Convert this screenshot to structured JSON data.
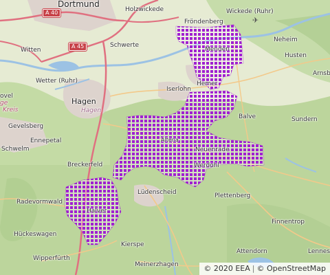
{
  "places": {
    "dortmund": "Dortmund",
    "holzwickede": "Holzwickede",
    "frondenberg": "Fröndenberg",
    "wickede": "Wickede (Ruhr)",
    "witten": "Witten",
    "schwerte": "Schwerte",
    "menden": "Menden",
    "neheim": "Neheim",
    "husten": "Husten",
    "arnsberg": "Arnsbe",
    "wetter": "Wetter (Ruhr)",
    "iserlohn": "Iserlohn",
    "hemer": "Hemer",
    "hagen": "Hagen",
    "hagen_region": "Hagen",
    "balve": "Balve",
    "sundern": "Sundern",
    "gevelsberg": "Gevelsberg",
    "ennepetal": "Ennepetal",
    "schwelm": "Schwelm",
    "altena": "Altena",
    "neuenrade": "Neuenrade",
    "werdohl": "Werdohl",
    "breckerfeld": "Breckerfeld",
    "ludenscheid": "Lüdenscheid",
    "plettenberg": "Plettenberg",
    "radevormwald": "Radevormwald",
    "halver": "Halver",
    "finnentrop": "Finnentrop",
    "huckeswagen": "Hückeswagen",
    "kierspe": "Kierspe",
    "attendorn": "Attendorn",
    "lennestadt": "Lennesta",
    "wipperfurth": "Wipperfürth",
    "meinerzhagen": "Meinerzhagen",
    "edge_ovel": "ovel",
    "edge_kreis": "Kreis",
    "edge_ge": "ge"
  },
  "roads": {
    "a40": "A 40",
    "a45": "A 45"
  },
  "icons": {
    "airport": "airport-icon"
  },
  "attribution": {
    "eea": "© 2020 EEA",
    "separator": "|",
    "osm": "© OpenStreetMap"
  },
  "colors": {
    "overlay": "#a020d0",
    "forest": "#b9d39a",
    "urban": "#ddd5cf",
    "water": "#aac9e6",
    "motorway": "#e07080"
  }
}
